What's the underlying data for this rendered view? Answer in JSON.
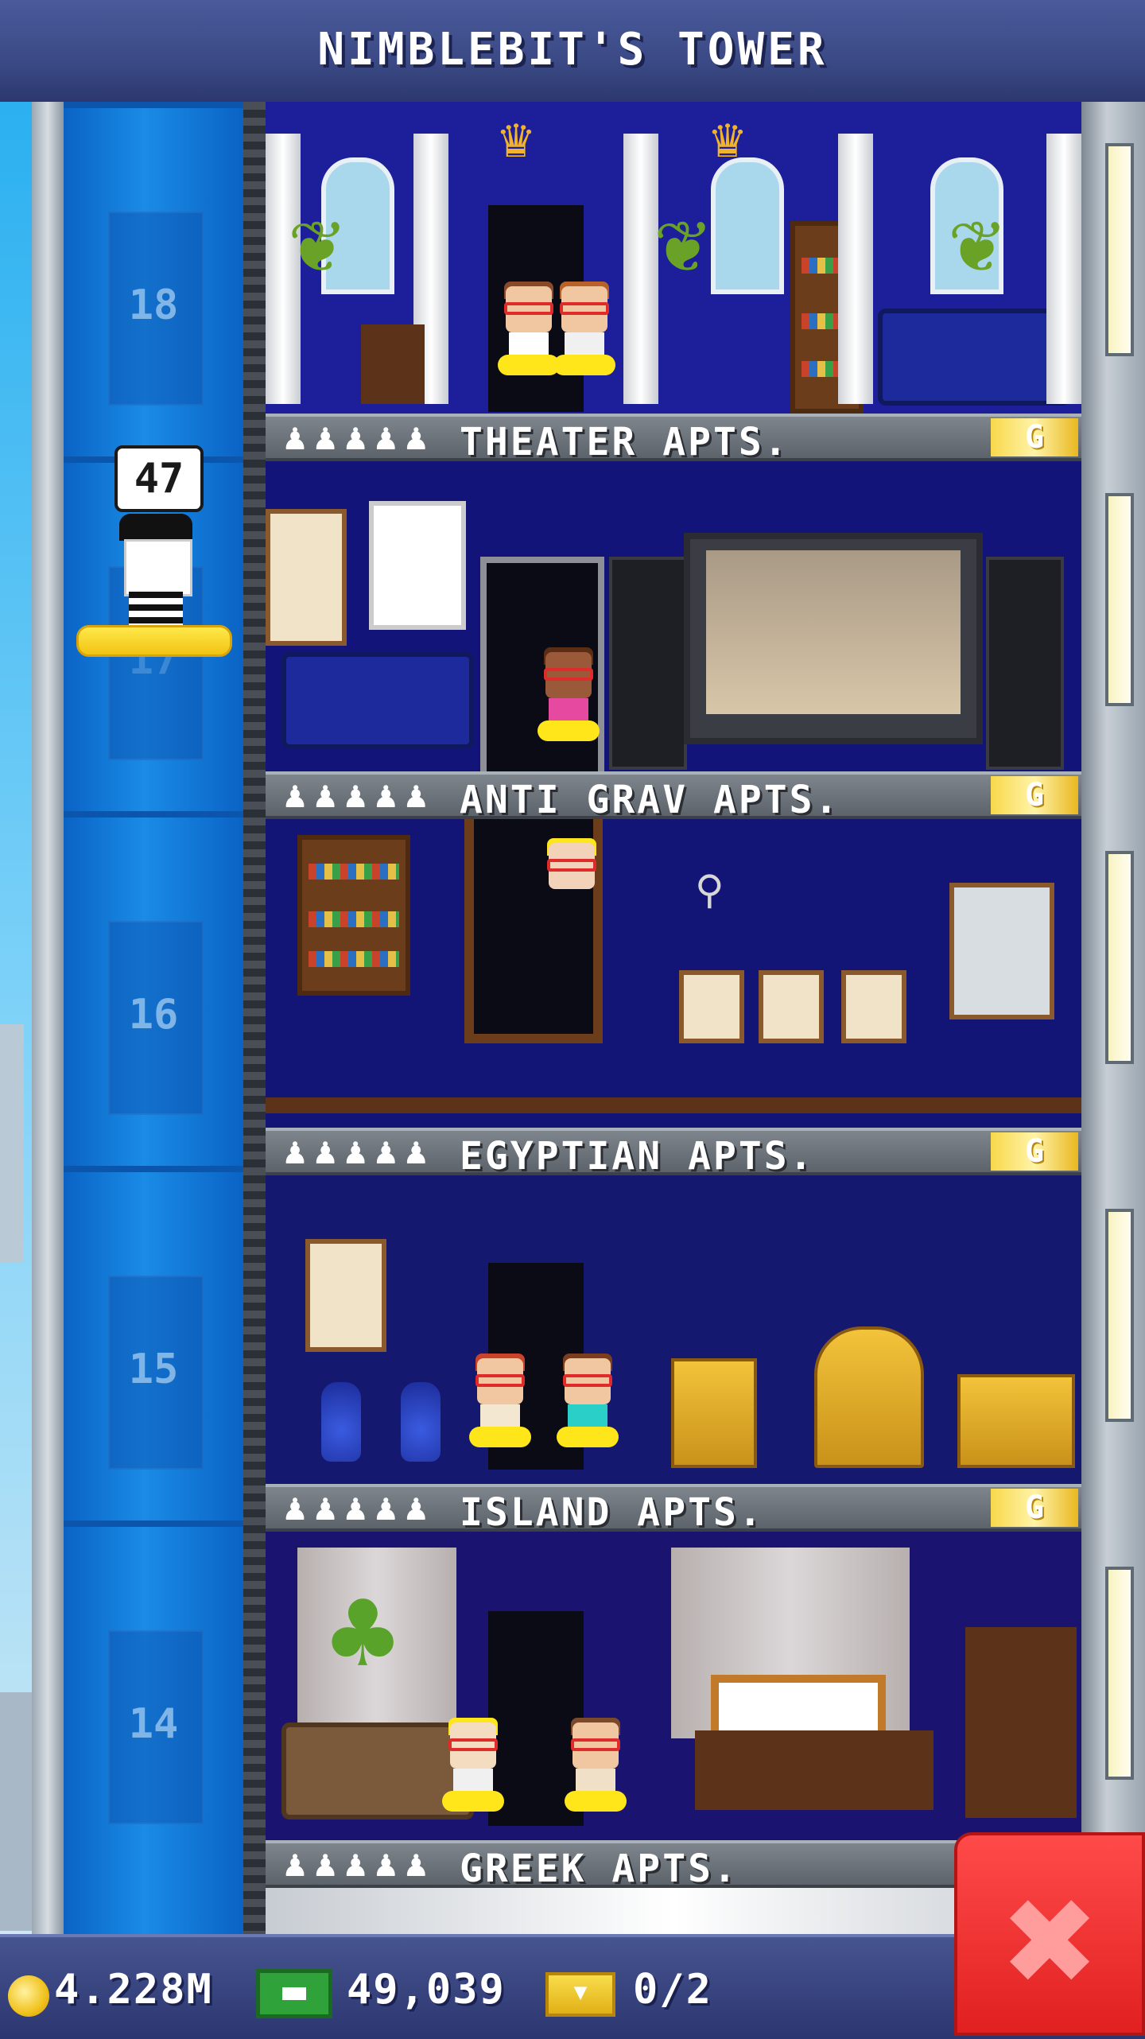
{
  "header": {
    "title": "NIMBLEBIT'S TOWER"
  },
  "elevator": {
    "passenger_destination": "47",
    "shaft_floor_numbers": [
      "18",
      "17",
      "16",
      "15",
      "14"
    ]
  },
  "floors": [
    {
      "name": "THEATER APTS.",
      "residents_icons": "♟♟♟♟♟",
      "badge": "G"
    },
    {
      "name": "ANTI GRAV APTS.",
      "residents_icons": "♟♟♟♟♟",
      "badge": "G"
    },
    {
      "name": "EGYPTIAN APTS.",
      "residents_icons": "♟♟♟♟♟",
      "badge": "G"
    },
    {
      "name": "ISLAND APTS.",
      "residents_icons": "♟♟♟♟♟",
      "badge": "G"
    },
    {
      "name": "GREEK APTS.",
      "residents_icons": "♟♟♟♟♟"
    }
  ],
  "hud": {
    "coins": "4.228M",
    "bux": "49,039",
    "tickets": "0/2",
    "icons": [
      "coin-icon",
      "bux-icon",
      "ticket-icon"
    ]
  },
  "close_button": {
    "icon": "close-icon",
    "glyph": "✖"
  },
  "colors": {
    "header": "#3b4a86",
    "elevator": "#1a8be6",
    "close": "#e12020",
    "gold": "#f7d84b"
  }
}
